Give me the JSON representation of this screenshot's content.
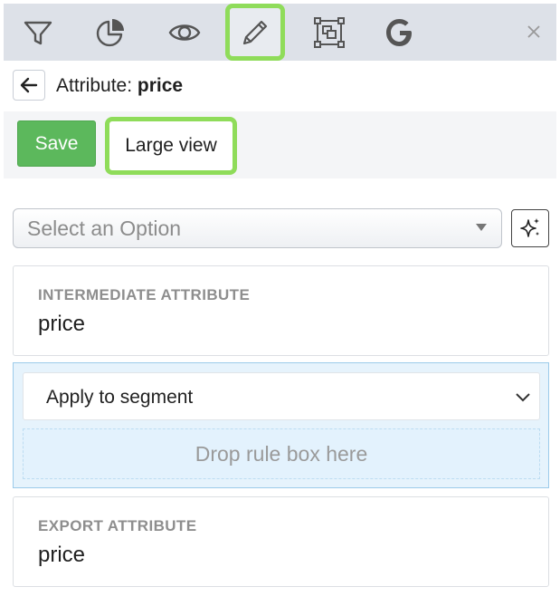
{
  "toolbar": {
    "icons": [
      {
        "name": "filter-icon"
      },
      {
        "name": "pie-chart-icon"
      },
      {
        "name": "eye-icon"
      },
      {
        "name": "pencil-icon",
        "active": true
      },
      {
        "name": "object-group-icon"
      },
      {
        "name": "google-icon"
      }
    ],
    "active_highlight_color": "#8fdc5a",
    "close_icon": "close-icon"
  },
  "header": {
    "title_prefix": "Attribute:",
    "title_name": "price"
  },
  "actions": {
    "save_label": "Save",
    "large_view_label": "Large view",
    "save_color": "#5cb85c"
  },
  "option_select": {
    "placeholder": "Select an Option"
  },
  "intermediate": {
    "label": "INTERMEDIATE ATTRIBUTE",
    "value": "price"
  },
  "segment": {
    "selected": "Apply to segment",
    "drop_zone_text": "Drop rule box here"
  },
  "export": {
    "label": "EXPORT ATTRIBUTE",
    "value": "price"
  }
}
